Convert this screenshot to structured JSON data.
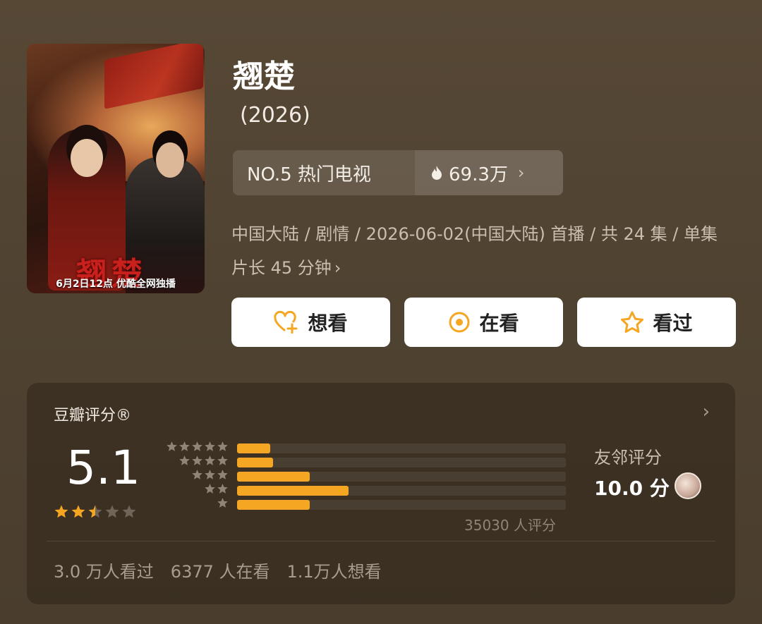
{
  "poster": {
    "calligraphy": "翘楚",
    "caption": "6月2日12点 优酷全网独播"
  },
  "title": "翘楚",
  "year": "(2026)",
  "rank": {
    "label": "NO.5 热门电视",
    "heat": "69.3万",
    "flame_icon": "flame-icon",
    "chevron": "›"
  },
  "meta": {
    "text": "中国大陆 / 剧情 / 2026-06-02(中国大陆) 首播 / 共 24 集 / 单集片长 45 分钟",
    "chevron": "›"
  },
  "actions": [
    {
      "label": "想看",
      "icon": "heart-plus-icon"
    },
    {
      "label": "在看",
      "icon": "target-icon"
    },
    {
      "label": "看过",
      "icon": "star-outline-icon"
    }
  ],
  "rating": {
    "heading": "豆瓣评分®",
    "score": "5.1",
    "stars": 2.5,
    "distribution": [
      {
        "stars": 5,
        "fraction": 0.1
      },
      {
        "stars": 4,
        "fraction": 0.11
      },
      {
        "stars": 3,
        "fraction": 0.22
      },
      {
        "stars": 2,
        "fraction": 0.34
      },
      {
        "stars": 1,
        "fraction": 0.22
      }
    ],
    "count": "35030 人评分",
    "friend_label": "友邻评分",
    "friend_score": "10.0 分",
    "chevron": "›"
  },
  "stats": [
    "3.0 万人看过",
    "6377 人在看",
    "1.1万人想看"
  ],
  "colors": {
    "accent": "#f5a623",
    "background": "#574836"
  }
}
